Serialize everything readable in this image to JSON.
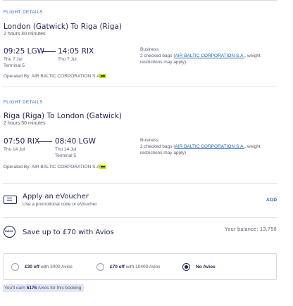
{
  "outbound": {
    "section_label": "FLIGHT DETAILS",
    "route": "London (Gatwick) To Riga (Riga)",
    "duration": "2 hours 40 minutes",
    "depart_time": "09:25 LGW",
    "arrive_time": "14:05 RIX",
    "depart_date": "Thu 7 Jul",
    "arrive_date": "Thu 7 Jul",
    "terminal": "Terminal 5",
    "cabin": "Business",
    "bags_prefix": "2 checked bags (",
    "bags_link": "AIR BALTIC CORPORATION S.A.",
    "bags_suffix": ", weight restrictions may apply)",
    "operated_by": "Operated By: AIR BALTIC CORPORATION S.A."
  },
  "inbound": {
    "section_label": "FLIGHT DETAILS",
    "route": "Riga (Riga) To London (Gatwick)",
    "duration": "2 hours 50 minutes",
    "depart_time": "07:50 RIX",
    "arrive_time": "08:40 LGW",
    "depart_date": "Thu 14 Jul",
    "arrive_date": "Thu 14 Jul",
    "terminal": "Terminal 5",
    "cabin": "Business",
    "bags_prefix": "2 checked bags (",
    "bags_link": "AIR BALTIC CORPORATION S.A.",
    "bags_suffix": ", weight restrictions may apply)",
    "operated_by": "Operated By: AIR BALTIC CORPORATION S.A."
  },
  "voucher": {
    "title": "Apply an eVoucher",
    "subtitle": "Use a promotional code or eVoucher",
    "add_label": "ADD"
  },
  "avios": {
    "badge_text": "avios",
    "title": "Save up to £70 with Avios",
    "balance": "Your balance: 13,750",
    "options": [
      {
        "bold": "£30 off",
        "rest": " with 3000 Avios",
        "selected": false
      },
      {
        "bold": "£70 off",
        "rest": " with 10400 Avios",
        "selected": false
      },
      {
        "bold": "No Avios",
        "rest": "",
        "selected": true
      }
    ],
    "earn_prefix": "You'll earn ",
    "earn_amount": "5176",
    "earn_suffix": " Avios for this booking."
  },
  "colors": {
    "accent": "#1f62b5",
    "navy": "#1e2350",
    "airline_badge": "#c9e000"
  }
}
